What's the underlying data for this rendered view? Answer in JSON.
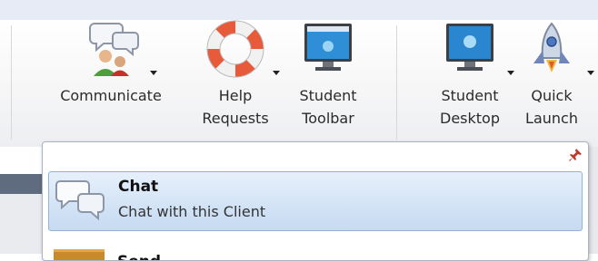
{
  "ribbon": {
    "buttons": [
      {
        "id": "communicate",
        "label_line1": "Communicate",
        "label_line2": "",
        "icon": "people-chat-icon",
        "has_dropdown": true
      },
      {
        "id": "help-requests",
        "label_line1": "Help",
        "label_line2": "Requests",
        "icon": "lifebuoy-icon",
        "has_dropdown": true
      },
      {
        "id": "student-toolbar",
        "label_line1": "Student",
        "label_line2": "Toolbar",
        "icon": "toolbar-monitor-icon",
        "has_dropdown": false
      },
      {
        "id": "student-desktop",
        "label_line1": "Student",
        "label_line2": "Desktop",
        "icon": "desktop-monitor-icon",
        "has_dropdown": true
      },
      {
        "id": "quick-launch",
        "label_line1": "Quick",
        "label_line2": "Launch",
        "icon": "rocket-icon",
        "has_dropdown": true
      }
    ]
  },
  "dropdown": {
    "pinned": true,
    "items": [
      {
        "title": "Chat",
        "description": "Chat with this Client",
        "icon": "chat-bubbles-icon",
        "highlighted": true
      },
      {
        "title": "Send",
        "description": "",
        "icon": "folder-icon",
        "highlighted": false
      }
    ]
  },
  "colors": {
    "ribbon_bg": "#f6f6f7",
    "highlight_bg": "#c6daf2",
    "highlight_border": "#94b3d8",
    "dark_bar": "#5f6b7f"
  }
}
